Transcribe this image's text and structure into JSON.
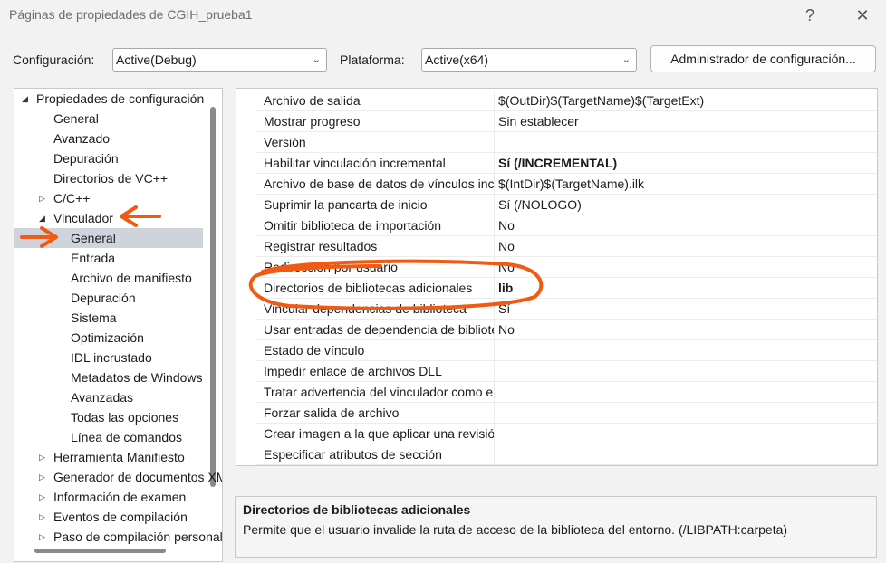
{
  "window": {
    "title": "Páginas de propiedades de CGIH_prueba1",
    "help_glyph": "?",
    "close_glyph": "✕"
  },
  "toolbar": {
    "config_label": "Configuración:",
    "config_value": "Active(Debug)",
    "platform_label": "Plataforma:",
    "platform_value": "Active(x64)",
    "manager_button": "Administrador de configuración..."
  },
  "tree": {
    "items": [
      {
        "label": "Propiedades de configuración",
        "level": 0,
        "toggle": "expanded"
      },
      {
        "label": "General",
        "level": 1,
        "toggle": "none"
      },
      {
        "label": "Avanzado",
        "level": 1,
        "toggle": "none"
      },
      {
        "label": "Depuración",
        "level": 1,
        "toggle": "none"
      },
      {
        "label": "Directorios de VC++",
        "level": 1,
        "toggle": "none"
      },
      {
        "label": "C/C++",
        "level": 1,
        "toggle": "collapsed"
      },
      {
        "label": "Vinculador",
        "level": 1,
        "toggle": "expanded"
      },
      {
        "label": "General",
        "level": 2,
        "toggle": "none",
        "selected": true
      },
      {
        "label": "Entrada",
        "level": 2,
        "toggle": "none"
      },
      {
        "label": "Archivo de manifiesto",
        "level": 2,
        "toggle": "none"
      },
      {
        "label": "Depuración",
        "level": 2,
        "toggle": "none"
      },
      {
        "label": "Sistema",
        "level": 2,
        "toggle": "none"
      },
      {
        "label": "Optimización",
        "level": 2,
        "toggle": "none"
      },
      {
        "label": "IDL incrustado",
        "level": 2,
        "toggle": "none"
      },
      {
        "label": "Metadatos de Windows",
        "level": 2,
        "toggle": "none"
      },
      {
        "label": "Avanzadas",
        "level": 2,
        "toggle": "none"
      },
      {
        "label": "Todas las opciones",
        "level": 2,
        "toggle": "none"
      },
      {
        "label": "Línea de comandos",
        "level": 2,
        "toggle": "none"
      },
      {
        "label": "Herramienta Manifiesto",
        "level": 1,
        "toggle": "collapsed"
      },
      {
        "label": "Generador de documentos XML",
        "level": 1,
        "toggle": "collapsed"
      },
      {
        "label": "Información de examen",
        "level": 1,
        "toggle": "collapsed"
      },
      {
        "label": "Eventos de compilación",
        "level": 1,
        "toggle": "collapsed"
      },
      {
        "label": "Paso de compilación personalizado",
        "level": 1,
        "toggle": "collapsed"
      }
    ]
  },
  "properties": [
    {
      "name": "Archivo de salida",
      "value": "$(OutDir)$(TargetName)$(TargetExt)",
      "bold": false
    },
    {
      "name": "Mostrar progreso",
      "value": "Sin establecer",
      "bold": false
    },
    {
      "name": "Versión",
      "value": "",
      "bold": false
    },
    {
      "name": "Habilitar vinculación incremental",
      "value": "Sí (/INCREMENTAL)",
      "bold": true
    },
    {
      "name": "Archivo de base de datos de vínculos incrementales",
      "value": "$(IntDir)$(TargetName).ilk",
      "bold": false
    },
    {
      "name": "Suprimir la pancarta de inicio",
      "value": "Sí (/NOLOGO)",
      "bold": false
    },
    {
      "name": "Omitir biblioteca de importación",
      "value": "No",
      "bold": false
    },
    {
      "name": "Registrar resultados",
      "value": "No",
      "bold": false
    },
    {
      "name": "Redirección por usuario",
      "value": "No",
      "bold": false
    },
    {
      "name": "Directorios de bibliotecas adicionales",
      "value": "lib",
      "bold": true
    },
    {
      "name": "Vincular dependencias de biblioteca",
      "value": "Sí",
      "bold": false
    },
    {
      "name": "Usar entradas de dependencia de biblioteca",
      "value": "No",
      "bold": false
    },
    {
      "name": "Estado de vínculo",
      "value": "",
      "bold": false
    },
    {
      "name": "Impedir enlace de archivos DLL",
      "value": "",
      "bold": false
    },
    {
      "name": "Tratar advertencia del vinculador como error",
      "value": "",
      "bold": false
    },
    {
      "name": "Forzar salida de archivo",
      "value": "",
      "bold": false
    },
    {
      "name": "Crear imagen a la que aplicar una revisión",
      "value": "",
      "bold": false
    },
    {
      "name": "Especificar atributos de sección",
      "value": "",
      "bold": false
    }
  ],
  "description": {
    "title": "Directorios de bibliotecas adicionales",
    "text": "Permite que el usuario invalide la ruta de acceso de la biblioteca del entorno. (/LIBPATH:carpeta)"
  },
  "annotation_color": "#f05a12"
}
